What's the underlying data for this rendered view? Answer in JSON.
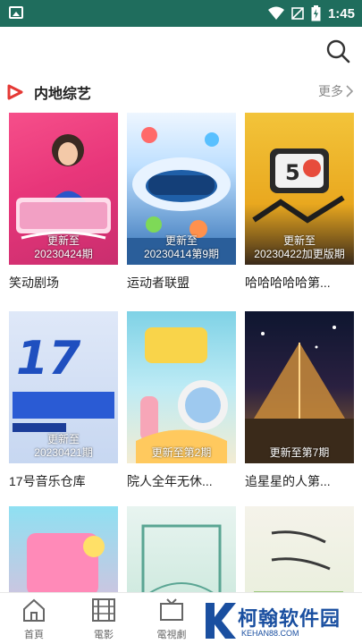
{
  "status_bar": {
    "time": "1:45"
  },
  "header": {
    "search_icon": "search-icon"
  },
  "section": {
    "title": "内地综艺",
    "more_label": "更多",
    "accent_color": "#e53935"
  },
  "cards": [
    {
      "title": "笑动剧场",
      "badge": "更新至\n20230424期"
    },
    {
      "title": "运动者联盟",
      "badge": "更新至\n20230414第9期"
    },
    {
      "title": "哈哈哈哈哈第...",
      "badge": "更新至\n20230422加更版期"
    },
    {
      "title": "17号音乐仓库",
      "badge": "更新至\n20230421期"
    },
    {
      "title": "院人全年无休...",
      "badge": "更新至第2期"
    },
    {
      "title": "追星星的人第...",
      "badge": "更新至第7期"
    },
    {
      "title": "",
      "badge": ""
    },
    {
      "title": "",
      "badge": ""
    },
    {
      "title": "",
      "badge": ""
    }
  ],
  "bottom_nav": [
    {
      "label": "首頁",
      "icon": "home-icon"
    },
    {
      "label": "電影",
      "icon": "film-icon"
    },
    {
      "label": "電視劇",
      "icon": "tv-icon"
    }
  ],
  "watermark": {
    "text": "柯翰软件园",
    "sub": "KEHAN88.COM"
  }
}
